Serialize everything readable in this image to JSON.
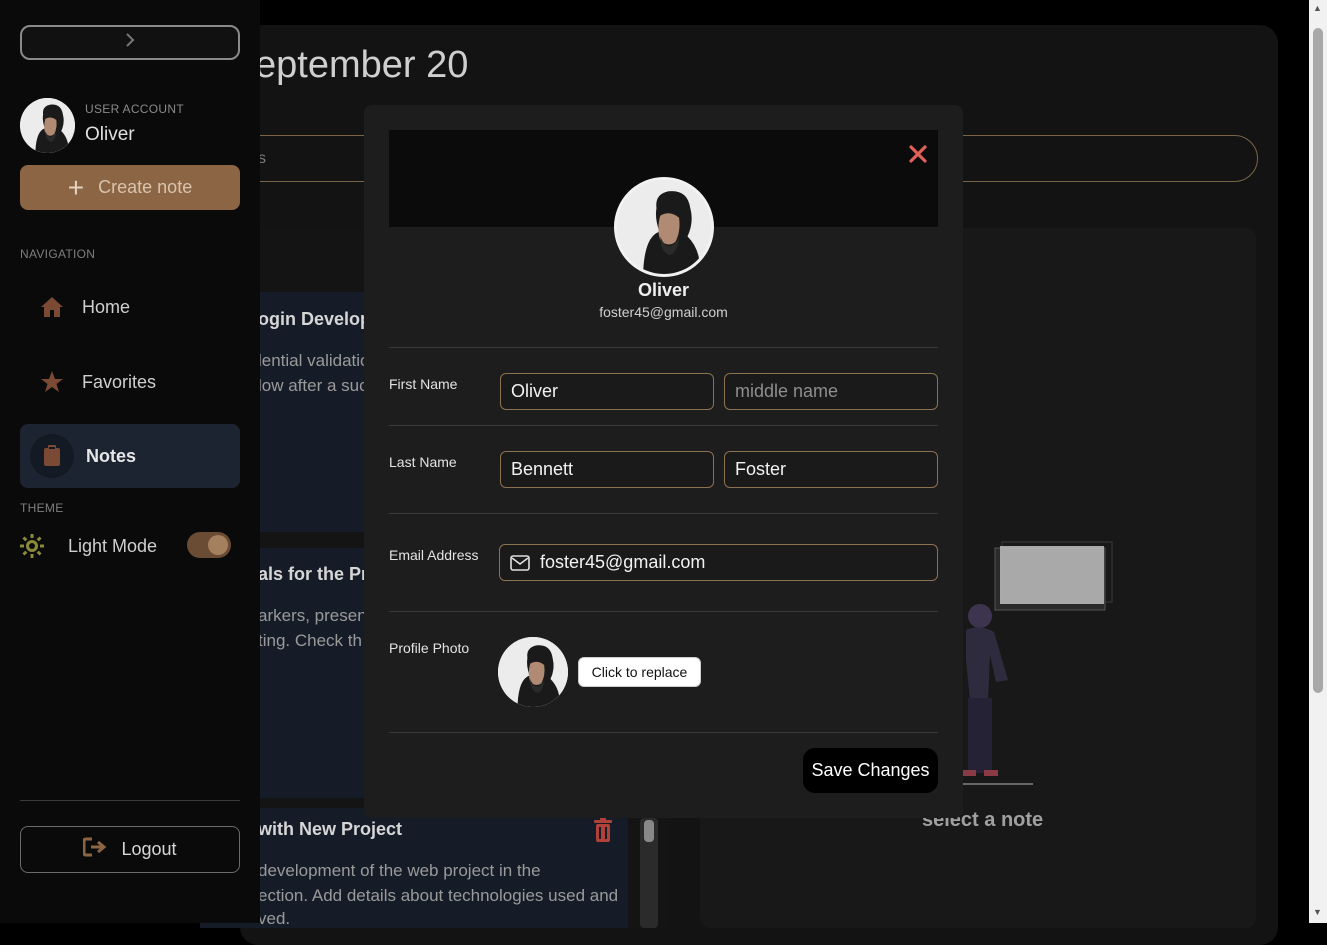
{
  "page": {
    "title": "eptember 20",
    "search_placeholder_fragment": "s",
    "empty_state": "select a note"
  },
  "notes": [
    {
      "title": "ogin Developr",
      "body": [
        "lential validatio",
        "low after a suc"
      ]
    },
    {
      "title": "als for the Pre",
      "body": [
        "arkers, present",
        "ting. Check th"
      ]
    },
    {
      "title": "with New Project",
      "body": [
        "development of the web project in the",
        "ection. Add details about technologies used and",
        "ved."
      ]
    }
  ],
  "sidebar": {
    "account_label": "USER ACCOUNT",
    "user_name": "Oliver",
    "create_note_label": "Create note",
    "navigation_label": "NAVIGATION",
    "nav_items": [
      {
        "label": "Home",
        "icon": "home-icon"
      },
      {
        "label": "Favorites",
        "icon": "star-icon"
      },
      {
        "label": "Notes",
        "icon": "clipboard-icon",
        "active": true
      }
    ],
    "theme_label": "THEME",
    "light_mode_label": "Light Mode",
    "light_mode_on": true,
    "logout_label": "Logout"
  },
  "modal": {
    "name": "Oliver",
    "email": "foster45@gmail.com",
    "first_name_label": "First Name",
    "first_name_value": "Oliver",
    "middle_name_placeholder": "middle name",
    "last_name_label": "Last Name",
    "last_name_value_1": "Bennett",
    "last_name_value_2": "Foster",
    "email_label": "Email Address",
    "email_value": "foster45@gmail.com",
    "photo_label": "Profile Photo",
    "replace_label": "Click to replace",
    "save_label": "Save Changes"
  },
  "colors": {
    "accent": "#8c6644",
    "input_border": "#8c7250",
    "close": "#e0605a"
  }
}
